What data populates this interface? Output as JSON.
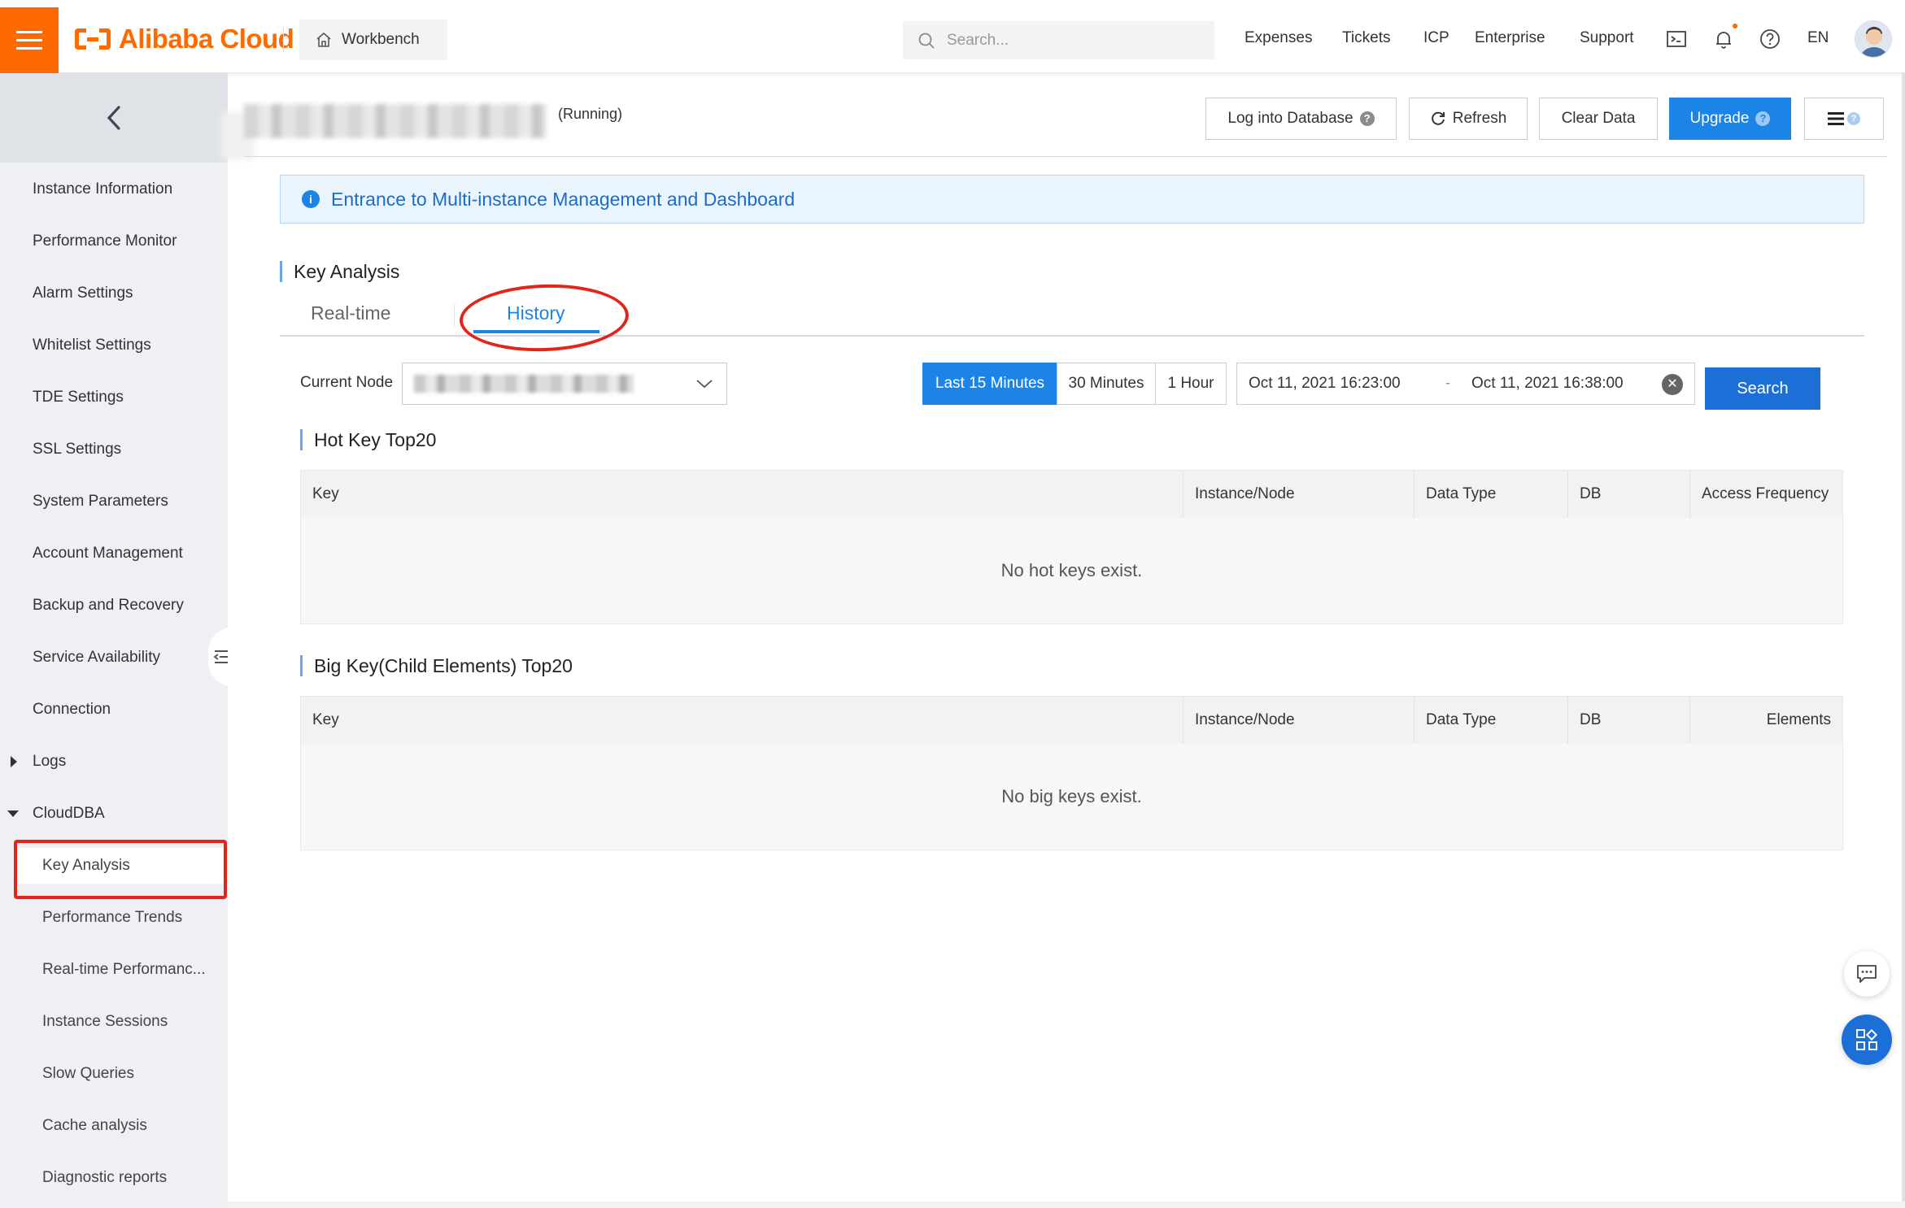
{
  "header": {
    "brand": "Alibaba Cloud",
    "workbench_label": "Workbench",
    "search_placeholder": "Search...",
    "nav": [
      "Expenses",
      "Tickets",
      "ICP",
      "Enterprise",
      "Support"
    ],
    "lang": "EN",
    "accent_color": "#ff6a00"
  },
  "sidebar": {
    "items": [
      {
        "label": "Instance Information"
      },
      {
        "label": "Performance Monitor"
      },
      {
        "label": "Alarm Settings"
      },
      {
        "label": "Whitelist Settings"
      },
      {
        "label": "TDE Settings"
      },
      {
        "label": "SSL Settings"
      },
      {
        "label": "System Parameters"
      },
      {
        "label": "Account Management"
      },
      {
        "label": "Backup and Recovery"
      },
      {
        "label": "Service Availability"
      },
      {
        "label": "Connection"
      },
      {
        "label": "Logs"
      },
      {
        "label": "CloudDBA"
      },
      {
        "label": "Key Analysis"
      },
      {
        "label": "Performance Trends"
      },
      {
        "label": "Real-time Performanc..."
      },
      {
        "label": "Instance Sessions"
      },
      {
        "label": "Slow Queries"
      },
      {
        "label": "Cache analysis"
      },
      {
        "label": "Diagnostic reports"
      }
    ],
    "active_item": "Key Analysis"
  },
  "instance": {
    "status": "(Running)"
  },
  "actions": {
    "log_into_db": "Log into Database",
    "refresh": "Refresh",
    "clear_data": "Clear Data",
    "upgrade": "Upgrade"
  },
  "notice": {
    "text": "Entrance to Multi-instance Management and Dashboard"
  },
  "key_analysis": {
    "title": "Key Analysis",
    "tabs": [
      "Real-time",
      "History"
    ],
    "active_tab": "History",
    "current_node_label": "Current Node",
    "time_ranges": [
      "Last 15 Minutes",
      "30 Minutes",
      "1 Hour"
    ],
    "active_range": "Last 15 Minutes",
    "start_time": "Oct 11, 2021 16:23:00",
    "range_separator": "-",
    "end_time": "Oct 11, 2021 16:38:00",
    "search_label": "Search"
  },
  "hot_keys": {
    "title": "Hot Key Top20",
    "columns": [
      "Key",
      "Instance/Node",
      "Data Type",
      "DB",
      "Access Frequency"
    ],
    "empty_text": "No hot keys exist."
  },
  "big_keys": {
    "title": "Big Key(Child Elements) Top20",
    "columns": [
      "Key",
      "Instance/Node",
      "Data Type",
      "DB",
      "Elements"
    ],
    "empty_text": "No big keys exist."
  }
}
